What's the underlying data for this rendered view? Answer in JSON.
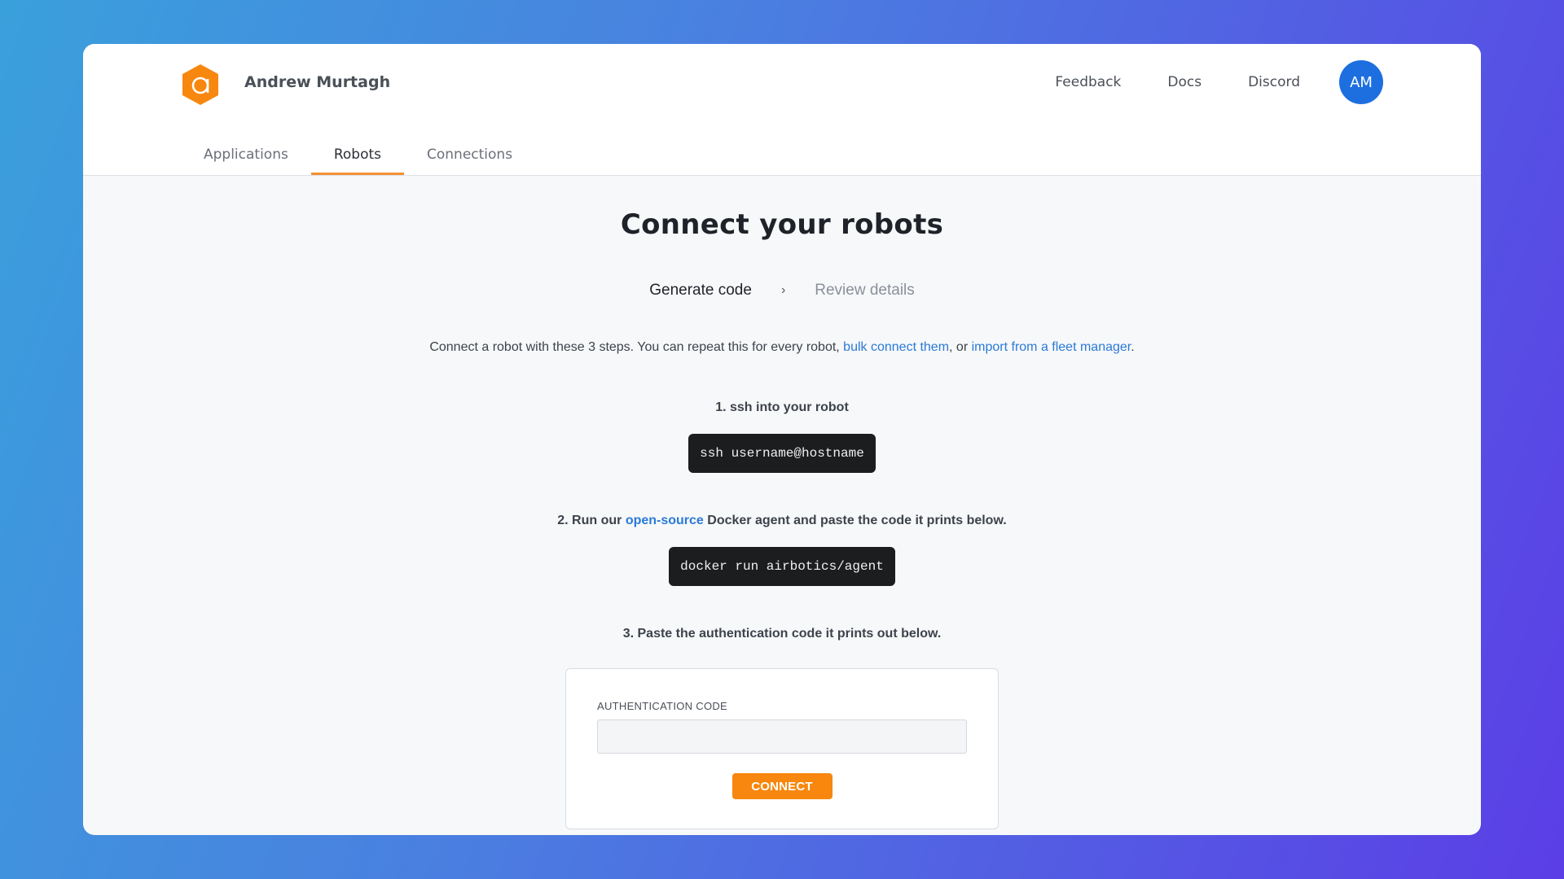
{
  "header": {
    "org_name": "Andrew Murtagh",
    "logo_letter": "a",
    "nav": [
      {
        "label": "Feedback"
      },
      {
        "label": "Docs"
      },
      {
        "label": "Discord"
      }
    ],
    "avatar_initials": "AM"
  },
  "tabs": [
    {
      "label": "Applications",
      "active": false
    },
    {
      "label": "Robots",
      "active": true
    },
    {
      "label": "Connections",
      "active": false
    }
  ],
  "page": {
    "title": "Connect your robots",
    "stepper": {
      "step1": "Generate code",
      "separator": "›",
      "step2": "Review details"
    },
    "intro": {
      "text_before": "Connect a robot with these 3 steps. You can repeat this for every robot, ",
      "link1": "bulk connect them",
      "text_middle": ", or ",
      "link2": "import from a fleet manager",
      "text_after": "."
    },
    "steps": {
      "s1_heading": "1. ssh into your robot",
      "s1_code": "ssh username@hostname",
      "s2_before": "2. Run our ",
      "s2_link": "open-source",
      "s2_after": " Docker agent and paste the code it prints below.",
      "s2_code": "docker run airbotics/agent",
      "s3_heading": "3. Paste the authentication code it prints out below."
    },
    "auth_card": {
      "label": "AUTHENTICATION CODE",
      "input_value": "",
      "placeholder": "",
      "button_label": "CONNECT"
    }
  },
  "colors": {
    "accent": "#f59032",
    "button": "#f7870f",
    "avatar": "#1d6fe0",
    "link": "#2a7ad6"
  }
}
